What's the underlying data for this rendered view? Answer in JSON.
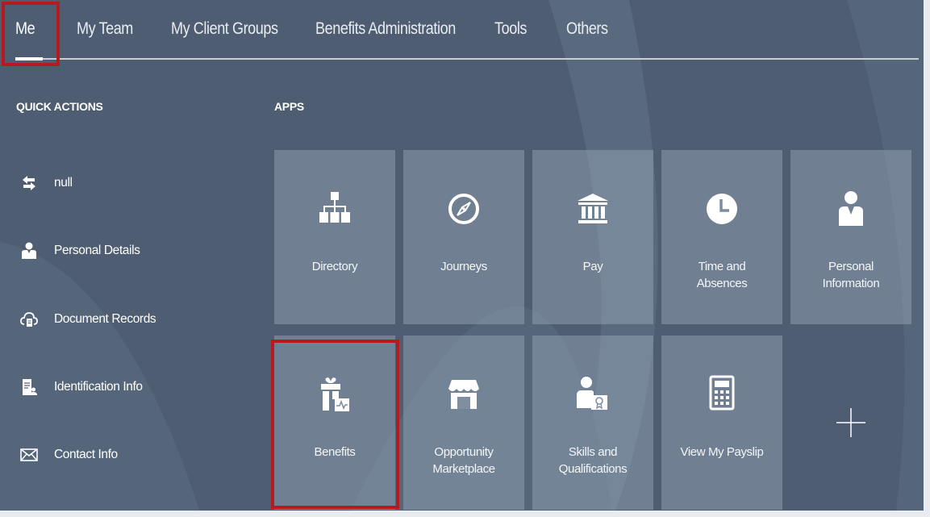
{
  "nav": {
    "tabs": [
      {
        "label": "Me",
        "active": true
      },
      {
        "label": "My Team",
        "active": false
      },
      {
        "label": "My Client Groups",
        "active": false
      },
      {
        "label": "Benefits Administration",
        "active": false
      },
      {
        "label": "Tools",
        "active": false
      },
      {
        "label": "Others",
        "active": false
      }
    ]
  },
  "quick_actions": {
    "heading": "QUICK ACTIONS",
    "items": [
      {
        "label": "null",
        "icon": "transfer-arrows-icon"
      },
      {
        "label": "Personal Details",
        "icon": "person-icon"
      },
      {
        "label": "Document Records",
        "icon": "cloud-document-icon"
      },
      {
        "label": "Identification Info",
        "icon": "id-document-icon"
      },
      {
        "label": "Contact Info",
        "icon": "envelope-icon"
      }
    ]
  },
  "apps": {
    "heading": "APPS",
    "tiles": [
      {
        "line1": "Directory",
        "line2": "",
        "icon": "org-chart-icon"
      },
      {
        "line1": "Journeys",
        "line2": "",
        "icon": "compass-icon"
      },
      {
        "line1": "Pay",
        "line2": "",
        "icon": "bank-icon"
      },
      {
        "line1": "Time and",
        "line2": "Absences",
        "icon": "clock-icon"
      },
      {
        "line1": "Personal",
        "line2": "Information",
        "icon": "person-badge-icon"
      },
      {
        "line1": "Benefits",
        "line2": "",
        "icon": "gift-health-icon"
      },
      {
        "line1": "Opportunity",
        "line2": "Marketplace",
        "icon": "storefront-icon"
      },
      {
        "line1": "Skills and",
        "line2": "Qualifications",
        "icon": "person-certificate-icon"
      },
      {
        "line1": "View My Payslip",
        "line2": "",
        "icon": "calculator-icon"
      }
    ],
    "add_tile_icon": "plus-icon"
  },
  "colors": {
    "background": "#4e5d71",
    "tile": "#7f8fa2",
    "highlight": "#b61a1f"
  }
}
